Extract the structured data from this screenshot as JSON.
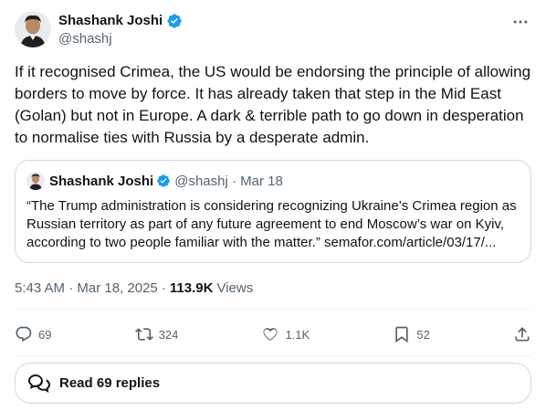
{
  "author": {
    "name": "Shashank Joshi",
    "handle": "@shashj"
  },
  "tweet": {
    "text": "If it recognised Crimea, the US would be endorsing the principle of allowing borders to move by force. It has already taken that step in the Mid East (Golan) but not in Europe. A dark & terrible path to go down in desperation to normalise ties with Russia by a desperate admin."
  },
  "quote": {
    "name": "Shashank Joshi",
    "handle_date": "@shashj · Mar 18",
    "text": "“The Trump administration is considering recognizing Ukraine’s Crimea region as Russian territory as part of any future agreement to end Moscow’s war on Kyiv, according to two people familiar with the matter.” semafor.com/article/03/17/..."
  },
  "meta": {
    "timestamp": "5:43 AM · Mar 18, 2025 ·",
    "views_count": "113.9K",
    "views_label": "Views"
  },
  "actions": {
    "replies": "69",
    "reposts": "324",
    "likes": "1.1K",
    "bookmarks": "52"
  },
  "read_replies": {
    "label": "Read 69 replies"
  },
  "colors": {
    "verified": "#1d9bf0",
    "muted": "#536471",
    "text": "#0f1419",
    "border": "#cfd9de"
  },
  "icons": {
    "more": "more-horizontal-icon",
    "verified": "verified-badge-icon",
    "reply": "reply-icon",
    "repost": "repost-icon",
    "like": "heart-icon",
    "bookmark": "bookmark-icon",
    "share": "share-icon",
    "replies": "chat-bubbles-icon"
  }
}
